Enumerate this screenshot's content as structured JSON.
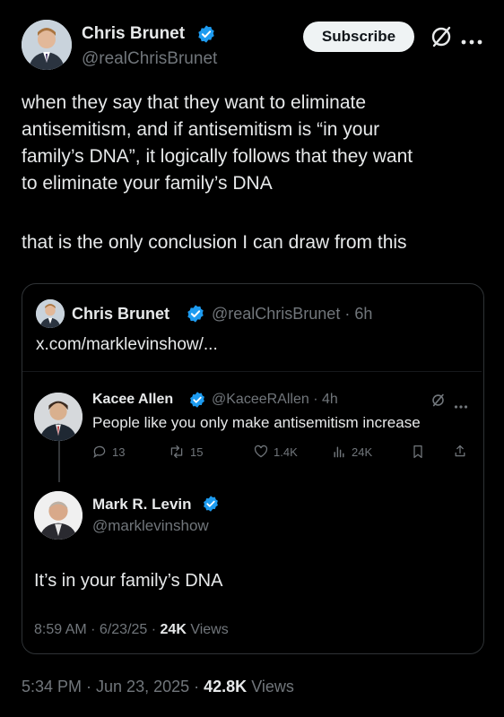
{
  "author": {
    "name": "Chris Brunet",
    "handle": "@realChrisBrunet",
    "subscribe_label": "Subscribe"
  },
  "tweet": {
    "line1": "when they say that they want to eliminate",
    "line2": "antisemitism, and if antisemitism is “in your",
    "line3": "family’s DNA”, it logically follows that they want",
    "line4": "to eliminate your family’s DNA",
    "line5": "that is the only conclusion I can draw from this",
    "timestamp": "5:34 PM · Jun 23, 2025 ·",
    "views_count": "42.8K",
    "views_label": "Views"
  },
  "quote": {
    "name": "Chris Brunet",
    "handle_time": "@realChrisBrunet · 6h",
    "link": "x.com/marklevinshow/..."
  },
  "reply": {
    "name": "Kacee Allen",
    "handle_time": "@KaceeRAllen · 4h",
    "text": "People like you only make antisemitism increase",
    "replies": "13",
    "reposts": "15",
    "likes": "1.4K",
    "views": "24K"
  },
  "main_post": {
    "name": "Mark R. Levin",
    "handle": "@marklevinshow",
    "text": "It’s in your family’s DNA",
    "timestamp": "8:59 AM · 6/23/25 ·",
    "views_count": "24K",
    "views_label": "Views"
  },
  "colors": {
    "verified_blue": "#1d9bf0",
    "background": "#000000",
    "muted": "#71767b"
  }
}
